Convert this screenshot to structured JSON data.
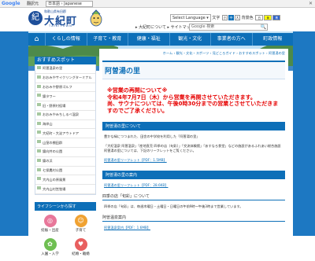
{
  "translate_bar": {
    "brand": "Google",
    "label": "翻訳元",
    "language": "日本語 › Japanese",
    "close": "✕"
  },
  "header": {
    "logo_small": "和歌山県有田郡",
    "logo_mark": "紀",
    "logo_name": "大紀町",
    "logo_roman": "T A I K I   T O W N",
    "select_language": "Select Language ▾",
    "font_label": "文字",
    "font_buttons": [
      "小",
      "中",
      "大"
    ],
    "bg_label": "背景色",
    "bg_buttons": [
      "白",
      "黄",
      "青"
    ],
    "links": "▸ 大紀町について  ▸ サイトマップ",
    "search_placeholder": "Google 検索",
    "search_icon": "🔍"
  },
  "nav": {
    "home_icon": "⌂",
    "items": [
      "くらしの情報",
      "子育て・教育",
      "健康・福祉",
      "観光・文化",
      "事業者の方へ",
      "町政情報"
    ]
  },
  "sidebar": {
    "heading": "おすすめスポット",
    "items": [
      "阿曽温泉の里",
      "おおみやサイクリングターミナル",
      "おおみや野原ゴルフ",
      "錦タワー",
      "旧・野原村役場",
      "おおみやみちしるべ温泉",
      "海岸山",
      "大紀町・大淀アウトドア",
      "山窪の棚田群",
      "錦向井の公園",
      "錦の浜",
      "七保農村公園",
      "大内山の原風景",
      "大内山村営牧場"
    ],
    "life_heading": "ライフシーンから探す",
    "life": [
      {
        "icon": "◎",
        "label": "妊娠・出産",
        "color": "#e8779a"
      },
      {
        "icon": "☺",
        "label": "子育て",
        "color": "#f0a232"
      },
      {
        "icon": "✿",
        "label": "入園・入学",
        "color": "#6fbf52"
      },
      {
        "icon": "♥",
        "label": "結婚・離婚",
        "color": "#e85f5f"
      }
    ]
  },
  "main": {
    "breadcrumb": "ホーム › 観光・文化・スポーツ › 見どころガイド › おすすめスポット › 阿曽湯の里",
    "title": "阿曽湯の里",
    "notice": "※営業の再開について※\n令和4年7月7日（木）から営業を再開させていただきます。\n尚、サウナについては、午後0時30分までの営業とさせていただきますのでご了承ください。",
    "section1": "阿曽湯の里について",
    "para1": "豊かな緑につつまれた、田舎の中学校を利用した「阿曽湯の里」",
    "para2": "「大紀温泉 阿曽温泉」「産地直売 四季の店（旬彩）」「交流体験館」「あすなろ食堂」などの施設があるふれあい総合施設阿曽湯の里については、下記のリーフレットをご覧ください。",
    "link1": "阿曽湯の里リーフレット【PDF：1.5MB】",
    "section2": "阿曽湯の里の案内",
    "link2": "阿曽湯の里リーフレット【PDF：28.6KB】",
    "sub1": "四季の店「旬彩」について",
    "para3": "四季の店「旬彩」は、毎週木曜日・土曜日・日曜日の午前9時～午後3時まで営業しています。",
    "sub2": "阿曽温泉案内",
    "link3": "阿曽温泉案内【PDF：1.6MB】"
  }
}
